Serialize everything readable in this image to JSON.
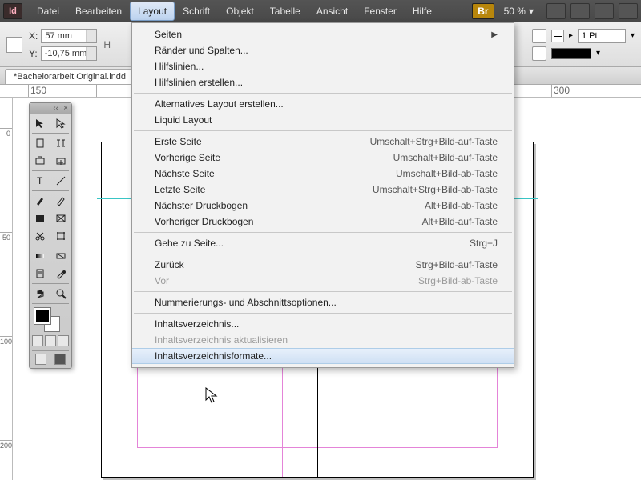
{
  "app_initials": "Id",
  "br_label": "Br",
  "menu": {
    "items": [
      "Datei",
      "Bearbeiten",
      "Layout",
      "Schrift",
      "Objekt",
      "Tabelle",
      "Ansicht",
      "Fenster",
      "Hilfe"
    ],
    "active_index": 2
  },
  "zoom": {
    "value": "50 %"
  },
  "coords": {
    "x_label": "X:",
    "y_label": "Y:",
    "x": "57 mm",
    "y": "-10,75 mm",
    "h_label": "H"
  },
  "stroke": {
    "pt": "1 Pt"
  },
  "doc_tab": "*Bachelorarbeit Original.indd",
  "hruler_ticks": [
    {
      "pos": 35,
      "label": "150"
    },
    {
      "pos": 120,
      "label": ""
    },
    {
      "pos": 688,
      "label": "300"
    }
  ],
  "vruler_ticks": [
    {
      "pos": 38,
      "label": "0"
    },
    {
      "pos": 168,
      "label": "50"
    },
    {
      "pos": 298,
      "label": "100"
    },
    {
      "pos": 428,
      "label": "200"
    }
  ],
  "dropdown": {
    "groups": [
      [
        {
          "label": "Seiten",
          "submenu": true
        },
        {
          "label": "Ränder und Spalten..."
        },
        {
          "label": "Hilfslinien..."
        },
        {
          "label": "Hilfslinien erstellen..."
        }
      ],
      [
        {
          "label": "Alternatives Layout erstellen..."
        },
        {
          "label": "Liquid Layout"
        }
      ],
      [
        {
          "label": "Erste Seite",
          "shortcut": "Umschalt+Strg+Bild-auf-Taste"
        },
        {
          "label": "Vorherige Seite",
          "shortcut": "Umschalt+Bild-auf-Taste"
        },
        {
          "label": "Nächste Seite",
          "shortcut": "Umschalt+Bild-ab-Taste"
        },
        {
          "label": "Letzte Seite",
          "shortcut": "Umschalt+Strg+Bild-ab-Taste"
        },
        {
          "label": "Nächster Druckbogen",
          "shortcut": "Alt+Bild-ab-Taste"
        },
        {
          "label": "Vorheriger Druckbogen",
          "shortcut": "Alt+Bild-auf-Taste"
        }
      ],
      [
        {
          "label": "Gehe zu Seite...",
          "shortcut": "Strg+J"
        }
      ],
      [
        {
          "label": "Zurück",
          "shortcut": "Strg+Bild-auf-Taste"
        },
        {
          "label": "Vor",
          "shortcut": "Strg+Bild-ab-Taste",
          "disabled": true
        }
      ],
      [
        {
          "label": "Nummerierungs- und Abschnittsoptionen..."
        }
      ],
      [
        {
          "label": "Inhaltsverzeichnis..."
        },
        {
          "label": "Inhaltsverzeichnis aktualisieren",
          "disabled": true
        },
        {
          "label": "Inhaltsverzeichnisformate...",
          "hover": true
        }
      ]
    ]
  },
  "tool_icons": [
    "selection",
    "direct-selection",
    "page",
    "gap",
    "content-collector",
    "content-placer",
    "type",
    "line",
    "pen",
    "pencil",
    "rectangle",
    "rect-frame",
    "scissors",
    "free-transform",
    "gradient-swatch",
    "gradient-feather",
    "note",
    "eyedropper",
    "hand",
    "zoom"
  ]
}
